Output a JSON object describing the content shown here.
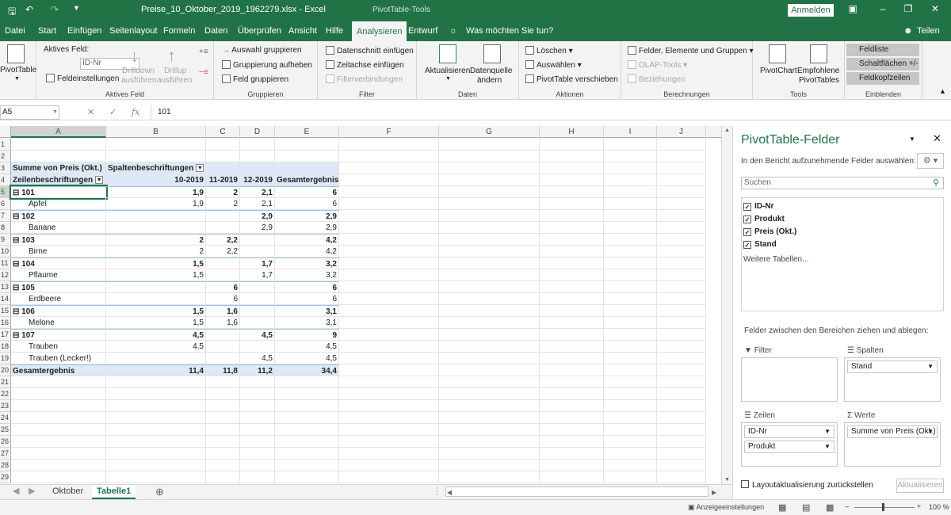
{
  "titlebar": {
    "title": "Preise_10_Oktober_2019_1962279.xlsx  -  Excel",
    "tools": "PivotTable-Tools",
    "signin": "Anmelden"
  },
  "tabs": [
    "Datei",
    "Start",
    "Einfügen",
    "Seitenlayout",
    "Formeln",
    "Daten",
    "Überprüfen",
    "Ansicht",
    "Hilfe",
    "Analysieren",
    "Entwurf"
  ],
  "tellme": "Was möchten Sie tun?",
  "share": "Teilen",
  "ribbon": {
    "pivottable": "PivotTable",
    "active_field_label": "Aktives Feld:",
    "active_field_value": "ID-Nr",
    "field_settings": "Feldeinstellungen",
    "drilldown": [
      "Drilldown",
      "ausführen"
    ],
    "drillup": [
      "Drillup",
      "ausführen"
    ],
    "group_active": "Aktives Feld",
    "sel_group": "Auswahl gruppieren",
    "ungroup": "Gruppierung aufheben",
    "field_group": "Feld gruppieren",
    "group_grp": "Gruppieren",
    "slicer": "Datenschnitt einfügen",
    "timeline": "Zeitachse einfügen",
    "filterconn": "Filterverbindungen",
    "group_filter": "Filter",
    "refresh": "Aktualisieren",
    "datasource": [
      "Datenquelle",
      "ändern"
    ],
    "group_data": "Daten",
    "clear": "Löschen",
    "select": "Auswählen",
    "move": "PivotTable verschieben",
    "group_actions": "Aktionen",
    "fields_items": "Felder, Elemente und Gruppen",
    "olap": "OLAP-Tools",
    "relations": "Beziehungen",
    "group_calc": "Berechnungen",
    "pivotchart": "PivotChart",
    "recommended": [
      "Empfohlene",
      "PivotTables"
    ],
    "group_tools": "Tools",
    "fieldlist": "Feldliste",
    "buttons": "Schaltflächen +/-",
    "headers": "Feldkopfzeilen",
    "group_show": "Einblenden"
  },
  "formula": {
    "namebox": "A5",
    "value": "101"
  },
  "columns": [
    "A",
    "B",
    "C",
    "D",
    "E",
    "F",
    "G",
    "H",
    "I",
    "J"
  ],
  "rows": [
    "1",
    "2",
    "3",
    "4",
    "5",
    "6",
    "7",
    "8",
    "9",
    "10",
    "11",
    "12",
    "13",
    "14",
    "15",
    "16",
    "17",
    "18",
    "19",
    "20",
    "21",
    "22",
    "23",
    "24",
    "25",
    "26",
    "27",
    "28",
    "29"
  ],
  "pivot": {
    "corner": "Summe von Preis (Okt.)",
    "colheader": "Spaltenbeschriftungen",
    "rowheader": "Zeilenbeschriftungen",
    "cols": [
      "10-2019",
      "11-2019",
      "12-2019",
      "Gesamtergebnis"
    ],
    "body": [
      [
        "⊟ 101",
        "1,9",
        "2",
        "2,1",
        "6"
      ],
      [
        "Apfel",
        "1,9",
        "2",
        "2,1",
        "6"
      ],
      [
        "⊟ 102",
        "",
        "",
        "2,9",
        "2,9"
      ],
      [
        "Banane",
        "",
        "",
        "2,9",
        "2,9"
      ],
      [
        "⊟ 103",
        "2",
        "2,2",
        "",
        "4,2"
      ],
      [
        "Birne",
        "2",
        "2,2",
        "",
        "4,2"
      ],
      [
        "⊟ 104",
        "1,5",
        "",
        "1,7",
        "3,2"
      ],
      [
        "Pflaume",
        "1,5",
        "",
        "1,7",
        "3,2"
      ],
      [
        "⊟ 105",
        "",
        "6",
        "",
        "6"
      ],
      [
        "Erdbeere",
        "",
        "6",
        "",
        "6"
      ],
      [
        "⊟ 106",
        "1,5",
        "1,6",
        "",
        "3,1"
      ],
      [
        "Melone",
        "1,5",
        "1,6",
        "",
        "3,1"
      ],
      [
        "⊟ 107",
        "4,5",
        "",
        "4,5",
        "9"
      ],
      [
        "Trauben",
        "4,5",
        "",
        "",
        "4,5"
      ],
      [
        "Trauben (Lecker!)",
        "",
        "",
        "4,5",
        "4,5"
      ]
    ],
    "total": [
      "Gesamtergebnis",
      "11,4",
      "11,8",
      "11,2",
      "34,4"
    ]
  },
  "sheets": [
    "Oktober",
    "Tabelle1"
  ],
  "status": {
    "display": "Anzeigeeinstellungen",
    "zoom": "100 %"
  },
  "pane": {
    "title": "PivotTable-Felder",
    "subtitle": "In den Bericht aufzunehmende Felder auswählen:",
    "search": "Suchen",
    "fields": [
      "ID-Nr",
      "Produkt",
      "Preis (Okt.)",
      "Stand"
    ],
    "more": "Weitere Tabellen...",
    "drag": "Felder zwischen den Bereichen ziehen und ablegen:",
    "filter": "Filter",
    "columns": "Spalten",
    "rows": "Zeilen",
    "values": "Werte",
    "col_items": [
      "Stand"
    ],
    "row_items": [
      "ID-Nr",
      "Produkt"
    ],
    "val_items": [
      "Summe von Preis (Okt.)"
    ],
    "defer": "Layoutaktualisierung zurückstellen",
    "update": "Aktualisieren"
  },
  "colors": {
    "accent": "#217346",
    "pivot_header": "#dde9f6"
  }
}
